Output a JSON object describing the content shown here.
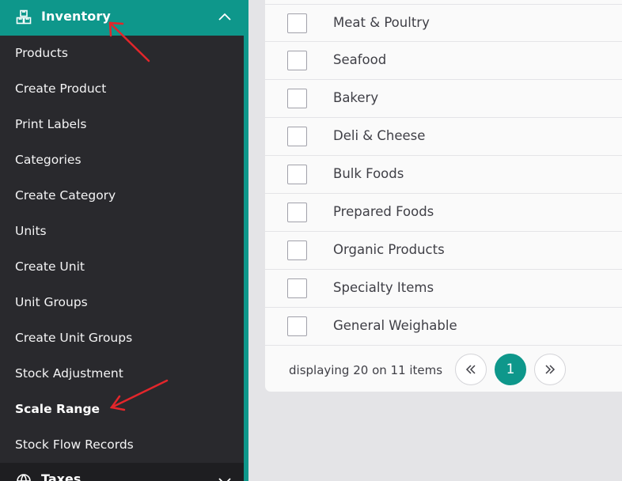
{
  "sidebar": {
    "section": {
      "title": "Inventory",
      "icon": "boxes-icon",
      "expanded_icon": "chevron-up-icon"
    },
    "items": [
      {
        "label": "Products"
      },
      {
        "label": "Create Product"
      },
      {
        "label": "Print Labels"
      },
      {
        "label": "Categories"
      },
      {
        "label": "Create Category"
      },
      {
        "label": "Units"
      },
      {
        "label": "Create Unit"
      },
      {
        "label": "Unit Groups"
      },
      {
        "label": "Create Unit Groups"
      },
      {
        "label": "Stock Adjustment"
      },
      {
        "label": "Scale Range",
        "active": true
      },
      {
        "label": "Stock Flow Records"
      }
    ],
    "next_section": {
      "title": "Taxes",
      "icon": "taxes-icon",
      "collapsed_icon": "chevron-down-icon"
    },
    "colors": {
      "accent": "#0e978b",
      "background": "#29292d"
    }
  },
  "table": {
    "rows": [
      {
        "label": "Meat & Poultry"
      },
      {
        "label": "Seafood"
      },
      {
        "label": "Bakery"
      },
      {
        "label": "Deli & Cheese"
      },
      {
        "label": "Bulk Foods"
      },
      {
        "label": "Prepared Foods"
      },
      {
        "label": "Organic Products"
      },
      {
        "label": "Specialty Items"
      },
      {
        "label": "General Weighable"
      }
    ]
  },
  "pagination": {
    "summary": "displaying 20 on 11 items",
    "current_page": "1",
    "prev_icon": "double-chevron-left-icon",
    "next_icon": "double-chevron-right-icon"
  },
  "annotations": {
    "arrow_color": "#e3262b"
  }
}
